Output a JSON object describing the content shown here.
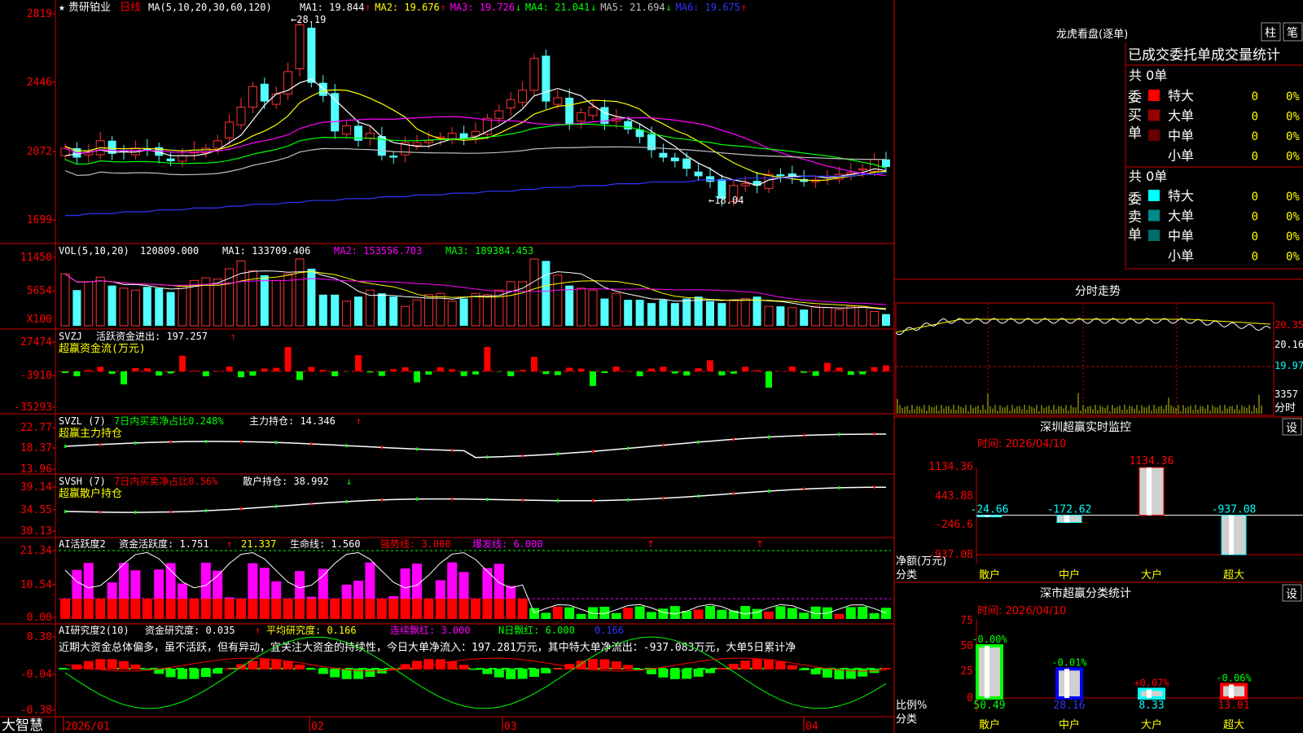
{
  "header": {
    "star_symbol": "★",
    "instrument": "贵研铂业",
    "period": "日线",
    "ma_params": "MA(5,10,20,30,60,120)",
    "ma_values": [
      {
        "name": "MA1",
        "value": "19.844",
        "arrow": "↑",
        "color": "#ffffff"
      },
      {
        "name": "MA2",
        "value": "19.676",
        "arrow": "↑",
        "color": "#ffff00"
      },
      {
        "name": "MA3",
        "value": "19.726",
        "arrow": "↓",
        "color": "#ff00ff"
      },
      {
        "name": "MA4",
        "value": "21.041",
        "arrow": "↓",
        "color": "#00ff00"
      },
      {
        "name": "MA5",
        "value": "21.694",
        "arrow": "↓",
        "color": "#c0c0c0"
      },
      {
        "name": "MA6",
        "value": "19.675",
        "arrow": "↑",
        "color": "#3333ff"
      }
    ],
    "price_high_label": "28.19",
    "price_low_label": "18.04"
  },
  "axes": {
    "price_ticks": [
      "2819",
      "2446",
      "2072",
      "1699"
    ],
    "vol_ticks": [
      "11450",
      "5654"
    ],
    "vol_unit": "X100",
    "svzj_ticks": [
      "27474",
      "-3910",
      "-35293"
    ],
    "svzl_ticks": [
      "22.77",
      "18.37",
      "13.96"
    ],
    "svsh_ticks": [
      "39.14",
      "34.55",
      "30.13"
    ],
    "ai_ticks": [
      "21.34",
      "10.54",
      "0.00"
    ],
    "ai2_ticks": [
      "0.30",
      "-0.04",
      "-0.38"
    ],
    "date_labels": [
      "2026/01",
      "02",
      "03",
      "04"
    ],
    "logo": "大智慧"
  },
  "vol_header": {
    "name": "VOL(5,10,20)",
    "value": "120809.000",
    "ma1": "MA1: 133709.406",
    "ma2": "MA2: 153556.703",
    "ma3": "MA3: 189384.453",
    "arrow_down": "↓"
  },
  "svzj_header": {
    "name": "SVZJ",
    "text": "活跃资金进出: 197.257",
    "arrow": "↑",
    "sub": "超赢资金流(万元)"
  },
  "svzl_header": {
    "name": "SVZL (7)",
    "pct": "7日内买卖净占比0.248%",
    "text": "主力持仓: 14.346",
    "arrow": "↑",
    "sub": "超赢主力持仓"
  },
  "svsh_header": {
    "name": "SVSH (7)",
    "pct": "7日内买卖净占比0.56%",
    "text": "散户持仓: 38.992",
    "arrow": "↓",
    "sub": "超赢散户持仓"
  },
  "ai_header": {
    "name": "AI活跃度2",
    "a": "资金活跃度: 1.751",
    "a_arrow": "↑",
    "b": "21.337",
    "c": "生命线: 1.560",
    "d": "强势线: 3.000",
    "e": "爆发线: 6.000",
    "arrow_up": "↑"
  },
  "ai2_header": {
    "name": "AI研究度2(10)",
    "a": "资金研究度: 0.035",
    "a_arrow": "↑",
    "b": "平均研究度: 0.166",
    "b_arrow": "↑",
    "c": "连续飘红: 3.000",
    "c_arrow": "↑",
    "d": "N日飘红: 6.000",
    "d_arrow": "↑",
    "e": "0.166",
    "e_arrow": "↑",
    "comment": "近期大资金总体偏多，虽不活跃，但有异动，宜关注大资金的持续性，今日大单净流入：197.281万元，其中特大单净流出：-937.083万元，大单5日累计净"
  },
  "right_panel": {
    "title": "龙虎看盘(逐单)",
    "btn_bar": "柱",
    "btn_note": "笔",
    "section_title": "已成交委托单成交量统计",
    "buy_label": "委买单",
    "sell_label": "委卖单",
    "buy_total": "共 0单",
    "sell_total": "共 0单",
    "buy_rows": [
      {
        "label": "特大",
        "count": "0",
        "pct": "0%",
        "color": "#ff0000"
      },
      {
        "label": "大单",
        "count": "0",
        "pct": "0%",
        "color": "#990000"
      },
      {
        "label": "中单",
        "count": "0",
        "pct": "0%",
        "color": "#660000"
      },
      {
        "label": "小单",
        "count": "0",
        "pct": "0%",
        "color": "#000000"
      }
    ],
    "sell_rows": [
      {
        "label": "特大",
        "count": "0",
        "pct": "0%",
        "color": "#00ffff"
      },
      {
        "label": "大单",
        "count": "0",
        "pct": "0%",
        "color": "#008b8b"
      },
      {
        "label": "中单",
        "count": "0",
        "pct": "0%",
        "color": "#006b6b"
      },
      {
        "label": "小单",
        "count": "0",
        "pct": "0%",
        "color": "#000000"
      }
    ],
    "intraday_title": "分时走势",
    "intraday_ticks": [
      "20.35",
      "20.16",
      "19.97",
      "3357"
    ],
    "intraday_unit": "分时",
    "sz_monitor_title": "深圳超赢实时监控",
    "settings_btn": "设",
    "sz_time": "时间: 2026/04/10",
    "sz_ticks": [
      "1134.36",
      "443.88",
      "-246.6",
      "-937.08"
    ],
    "sz_net_label": "净额(万元)",
    "sz_class_label": "分类",
    "sz_cats": [
      "散户",
      "中户",
      "大户",
      "超大"
    ],
    "sz_values": [
      -24.66,
      -172.62,
      1134.36,
      -937.08
    ],
    "sz_value_labels": [
      "-24.66",
      "-172.62",
      "1134.36",
      "-937.08"
    ],
    "class_title": "深市超赢分类统计",
    "class_time": "时间: 2026/04/10",
    "class_ticks": [
      "75",
      "50",
      "25",
      "0"
    ],
    "class_ratio_label": "比例%",
    "class_class_label": "分类",
    "class_cats": [
      "散户",
      "中户",
      "大户",
      "超大"
    ],
    "class_values": [
      50.49,
      28.16,
      8.33,
      13.01
    ],
    "class_value_labels": [
      "50.49",
      "28.16",
      "8.33",
      "13.01"
    ],
    "class_changes": [
      "-0.00%",
      "-0.01%",
      "+0.07%",
      "-0.06%"
    ],
    "class_colors": [
      "#00ff00",
      "#0000ff",
      "#00ffff",
      "#ff0000"
    ]
  },
  "chart_data": [
    {
      "type": "candlestick",
      "title": "贵研铂业 日线",
      "x": [
        "2026/01",
        "02",
        "03",
        "04"
      ],
      "ylim": [
        16.99,
        28.19
      ],
      "close": [
        21.0,
        20.5,
        20.8,
        21.4,
        20.7,
        20.8,
        21.0,
        20.9,
        20.6,
        20.3,
        20.6,
        20.9,
        21.0,
        21.4,
        22.4,
        23.2,
        24.3,
        23.5,
        23.9,
        25.1,
        27.6,
        24.5,
        23.8,
        21.9,
        22.2,
        21.4,
        21.8,
        20.6,
        20.5,
        21.3,
        21.3,
        21.4,
        21.6,
        21.8,
        21.5,
        21.9,
        22.6,
        23.0,
        23.6,
        24.1,
        25.8,
        23.5,
        23.7,
        22.3,
        22.9,
        23.2,
        22.3,
        22.6,
        22.0,
        21.6,
        20.9,
        20.5,
        20.3,
        19.9,
        19.5,
        19.2,
        18.3,
        19.0,
        19.1,
        19.0,
        19.6,
        19.5,
        19.5,
        19.2,
        19.3,
        19.5,
        19.6,
        19.7,
        19.9,
        20.4,
        20.0
      ],
      "volume": [
        80,
        55,
        68,
        75,
        62,
        58,
        55,
        60,
        58,
        52,
        62,
        70,
        74,
        72,
        88,
        100,
        85,
        78,
        70,
        80,
        103,
        88,
        48,
        48,
        38,
        45,
        55,
        50,
        45,
        30,
        40,
        48,
        50,
        38,
        42,
        50,
        48,
        55,
        68,
        68,
        103,
        100,
        78,
        62,
        58,
        55,
        42,
        50,
        40,
        40,
        35,
        40,
        35,
        42,
        45,
        38,
        35,
        40,
        42,
        45,
        30,
        30,
        28,
        25,
        30,
        28,
        25,
        30,
        30,
        22,
        18
      ],
      "ma5": [
        20.6,
        20.7,
        20.8,
        20.9,
        20.8,
        20.8,
        20.8,
        20.9,
        20.8,
        20.6,
        20.6,
        20.6,
        20.7,
        20.9,
        21.3,
        21.7,
        22.5,
        23.3,
        23.9,
        24.1,
        24.5,
        24.7,
        24.2,
        23.6,
        23.0,
        22.4,
        22.2,
        21.6,
        21.3,
        21.2,
        21.1,
        21.1,
        21.3,
        21.5,
        21.5,
        21.6,
        21.9,
        22.2,
        22.6,
        23.1,
        23.8,
        24.0,
        24.2,
        24.0,
        23.8,
        23.3,
        22.9,
        22.7,
        22.6,
        22.3,
        21.9,
        21.5,
        21.1,
        20.6,
        20.2,
        19.9,
        19.5,
        19.3,
        19.2,
        19.0,
        19.3,
        19.4,
        19.5,
        19.5,
        19.5,
        19.4,
        19.5,
        19.6,
        19.7,
        19.9,
        19.8
      ],
      "ma6": [
        17.4,
        17.4,
        17.5,
        17.5,
        17.5,
        17.6,
        17.6,
        17.6,
        17.7,
        17.7,
        17.7,
        17.8,
        17.8,
        17.8,
        17.9,
        17.9,
        18.0,
        18.0,
        18.0,
        18.1,
        18.1,
        18.2,
        18.2,
        18.2,
        18.3,
        18.3,
        18.3,
        18.4,
        18.4,
        18.4,
        18.5,
        18.5,
        18.5,
        18.6,
        18.6,
        18.6,
        18.7,
        18.7,
        18.7,
        18.8,
        18.8,
        18.9,
        18.9,
        18.9,
        19.0,
        19.0,
        19.0,
        19.1,
        19.1,
        19.1,
        19.2,
        19.2,
        19.2,
        19.2,
        19.3,
        19.3,
        19.3,
        19.3,
        19.4,
        19.4,
        19.4,
        19.4,
        19.4,
        19.5,
        19.5,
        19.5,
        19.5,
        19.5,
        19.6,
        19.6,
        19.7
      ]
    },
    {
      "type": "bar",
      "title": "深圳超赢实时监控",
      "categories": [
        "散户",
        "中户",
        "大户",
        "超大"
      ],
      "values": [
        -24.66,
        -172.62,
        1134.36,
        -937.08
      ],
      "ylabel": "净额(万元)",
      "ylim": [
        -937.08,
        1134.36
      ]
    },
    {
      "type": "bar",
      "title": "深市超赢分类统计",
      "categories": [
        "散户",
        "中户",
        "大户",
        "超大"
      ],
      "values": [
        50.49,
        28.16,
        8.33,
        13.01
      ],
      "ylabel": "比例%",
      "ylim": [
        0,
        75
      ]
    }
  ]
}
